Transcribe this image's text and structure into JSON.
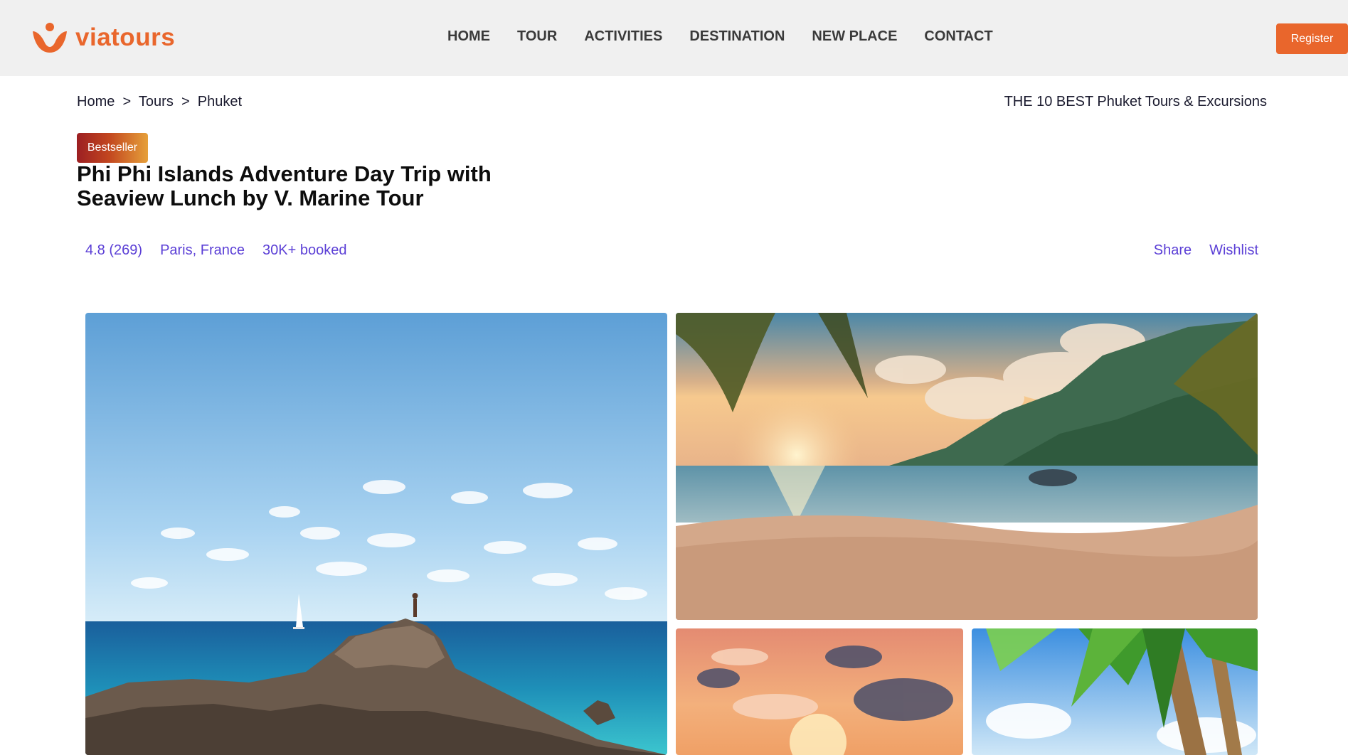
{
  "brand": {
    "name": "viatours",
    "color": "#e9662c"
  },
  "nav": {
    "items": [
      {
        "label": "HOME"
      },
      {
        "label": "TOUR"
      },
      {
        "label": "ACTIVITIES"
      },
      {
        "label": "DESTINATION"
      },
      {
        "label": "NEW PLACE"
      },
      {
        "label": "CONTACT"
      }
    ],
    "register_label": "Register"
  },
  "breadcrumb": {
    "items": [
      "Home",
      "Tours",
      "Phuket"
    ],
    "separator": ">"
  },
  "best_link": "THE 10 BEST Phuket Tours & Excursions",
  "listing": {
    "badge": "Bestseller",
    "title": "Phi Phi Islands Adventure Day Trip with Seaview Lunch by V. Marine Tour",
    "rating": "4.8 (269)",
    "location": "Paris, France",
    "booked": "30K+ booked",
    "share_label": "Share",
    "wishlist_label": "Wishlist"
  },
  "colors": {
    "accent": "#e9662c",
    "link": "#5b3fd6"
  },
  "gallery": [
    {
      "name": "rocky-coast-sailboat-photo"
    },
    {
      "name": "tropical-beach-sunset-photo"
    },
    {
      "name": "sunset-clouds-photo"
    },
    {
      "name": "palm-tree-sky-photo"
    }
  ]
}
